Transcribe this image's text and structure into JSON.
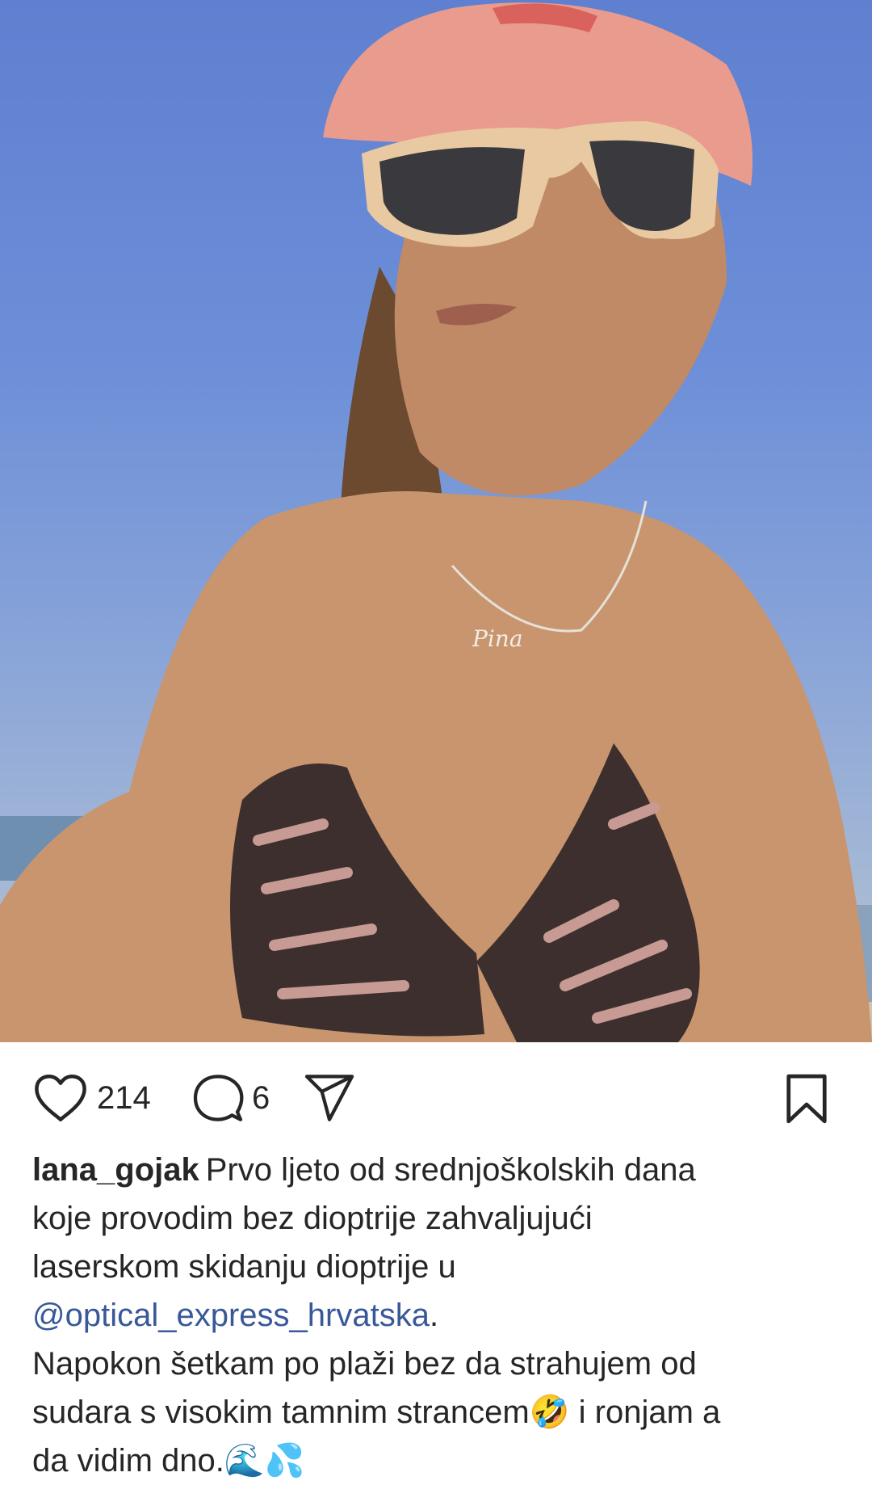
{
  "post": {
    "photo_alt": "",
    "likes": "214",
    "comments": "6"
  },
  "icons": {
    "like": "heart-icon",
    "comment": "comment-bubble-icon",
    "share": "paper-plane-icon",
    "save": "bookmark-icon"
  },
  "caption": {
    "username": "lana_gojak",
    "line1": "Prvo ljeto od srednjoškolskih dana",
    "line2": "koje provodim bez dioptrije zahvaljujući",
    "line3": "laserskom skidanju dioptrije u",
    "mention": "@optical_express_hrvatska",
    "after_mention": ".",
    "line5": "Napokon šetkam po plaži bez da strahujem od",
    "line6": "sudara s visokim tamnim strancem🤣 i ronjam a",
    "line7": "da vidim dno.🌊💦"
  },
  "colors": {
    "text": "#262626",
    "mention": "#385898",
    "sky": "#6d8fd8"
  }
}
